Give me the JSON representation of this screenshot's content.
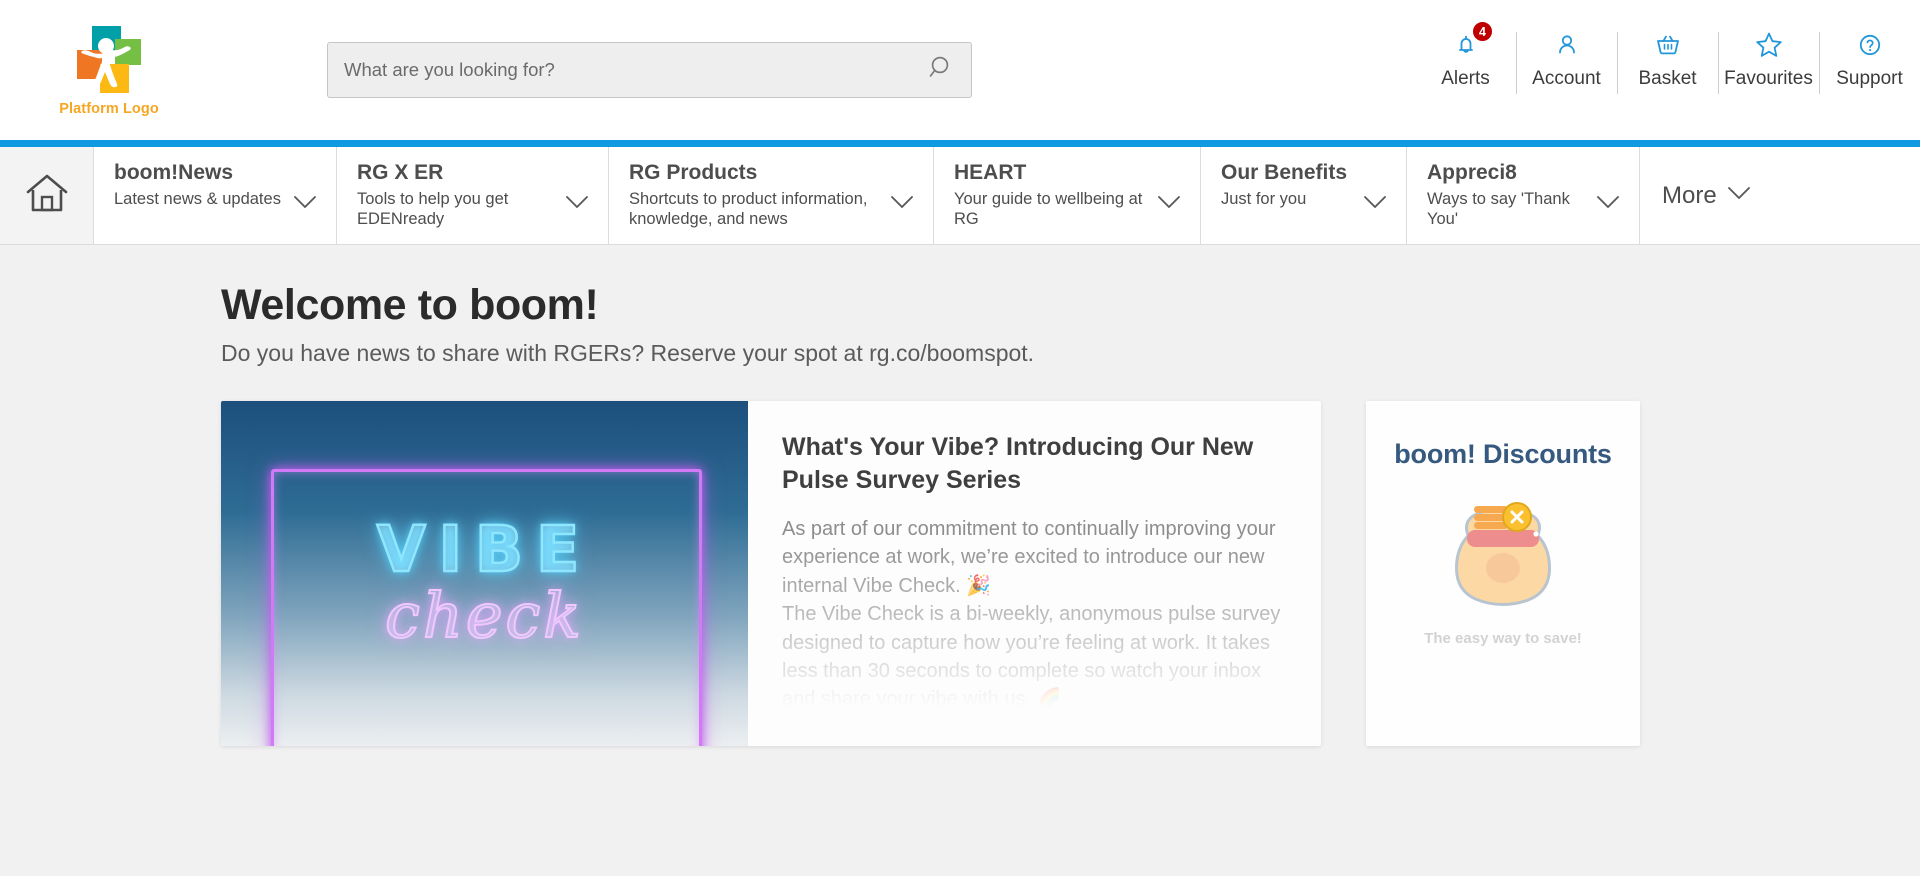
{
  "brand": {
    "logo_caption": "Platform Logo",
    "logo_icon": "pinwheel-person-logo",
    "accent_blue": "#0e9ae0",
    "icon_blue": "#2196d9",
    "logo_caption_color": "#f5a623",
    "badge_color": "#c00000"
  },
  "search": {
    "placeholder": "What are you looking for?",
    "value": "",
    "icon": "search-icon"
  },
  "header_actions": [
    {
      "label": "Alerts",
      "icon": "bell-icon",
      "badge": "4"
    },
    {
      "label": "Account",
      "icon": "person-icon",
      "badge": ""
    },
    {
      "label": "Basket",
      "icon": "basket-icon",
      "badge": ""
    },
    {
      "label": "Favourites",
      "icon": "star-icon",
      "badge": ""
    },
    {
      "label": "Support",
      "icon": "question-circle-icon",
      "badge": ""
    }
  ],
  "nav": {
    "home_icon": "home-icon",
    "items": [
      {
        "title": "boom!News",
        "subtitle": "Latest news & updates"
      },
      {
        "title": "RG X ER",
        "subtitle": "Tools to help you get EDENready"
      },
      {
        "title": "RG Products",
        "subtitle": "Shortcuts to product information, knowledge, and news"
      },
      {
        "title": "HEART",
        "subtitle": "Your guide to wellbeing at RG"
      },
      {
        "title": "Our Benefits",
        "subtitle": "Just for you"
      },
      {
        "title": "Appreci8",
        "subtitle": "Ways to say 'Thank You'"
      }
    ],
    "more_label": "More",
    "chevron_icon": "chevron-down-icon"
  },
  "main": {
    "title": "Welcome to boom!",
    "subtitle": "Do you have news to share with RGERs? Reserve your spot at rg.co/boomspot."
  },
  "article": {
    "media_word": "VIBE",
    "media_script": "check",
    "media_alt": "vibe-check-neon-sign",
    "title": "What's Your Vibe? Introducing Our New Pulse Survey Series",
    "paragraphs": [
      "As part of our commitment to continually improving your experience at work, we’re excited to introduce our new internal Vibe Check. 🎉",
      "The Vibe Check is a bi-weekly, anonymous pulse survey designed to capture how you’re feeling at work. It takes less than 30 seconds to complete so watch your inbox and share your vibe with us. 🌈"
    ]
  },
  "discounts": {
    "title": "boom! Discounts",
    "art": "money-pot-icon",
    "footer": "The easy way to save!",
    "title_color": "#35597f"
  }
}
